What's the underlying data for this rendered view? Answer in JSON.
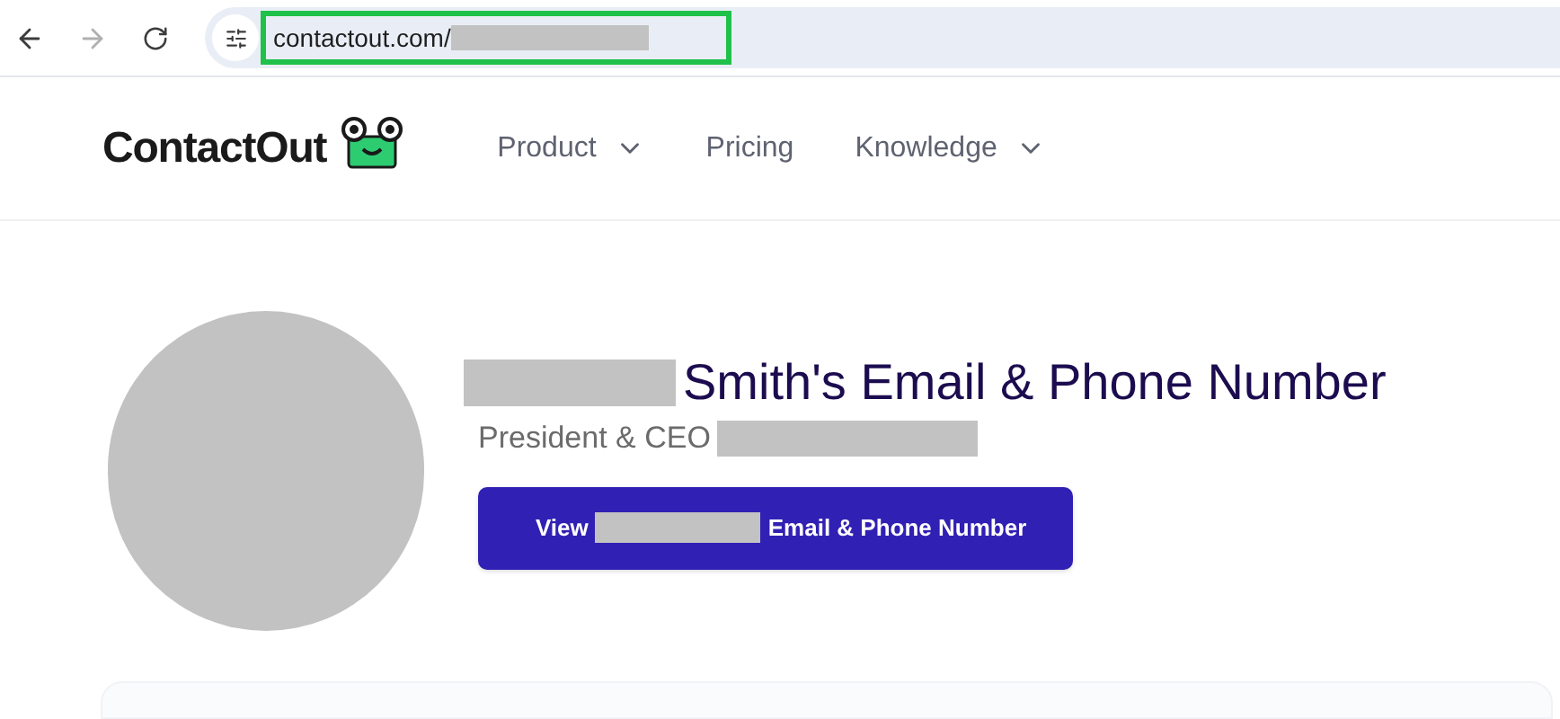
{
  "browser": {
    "url": "contactout.com/"
  },
  "nav": {
    "logo": "ContactOut",
    "items": [
      {
        "label": "Product",
        "dropdown": true
      },
      {
        "label": "Pricing",
        "dropdown": false
      },
      {
        "label": "Knowledge",
        "dropdown": true
      }
    ]
  },
  "profile": {
    "heading": "Smith's Email & Phone Number",
    "subtitle": "President & CEO",
    "button_prefix": "View",
    "button_suffix": "Email & Phone Number"
  }
}
